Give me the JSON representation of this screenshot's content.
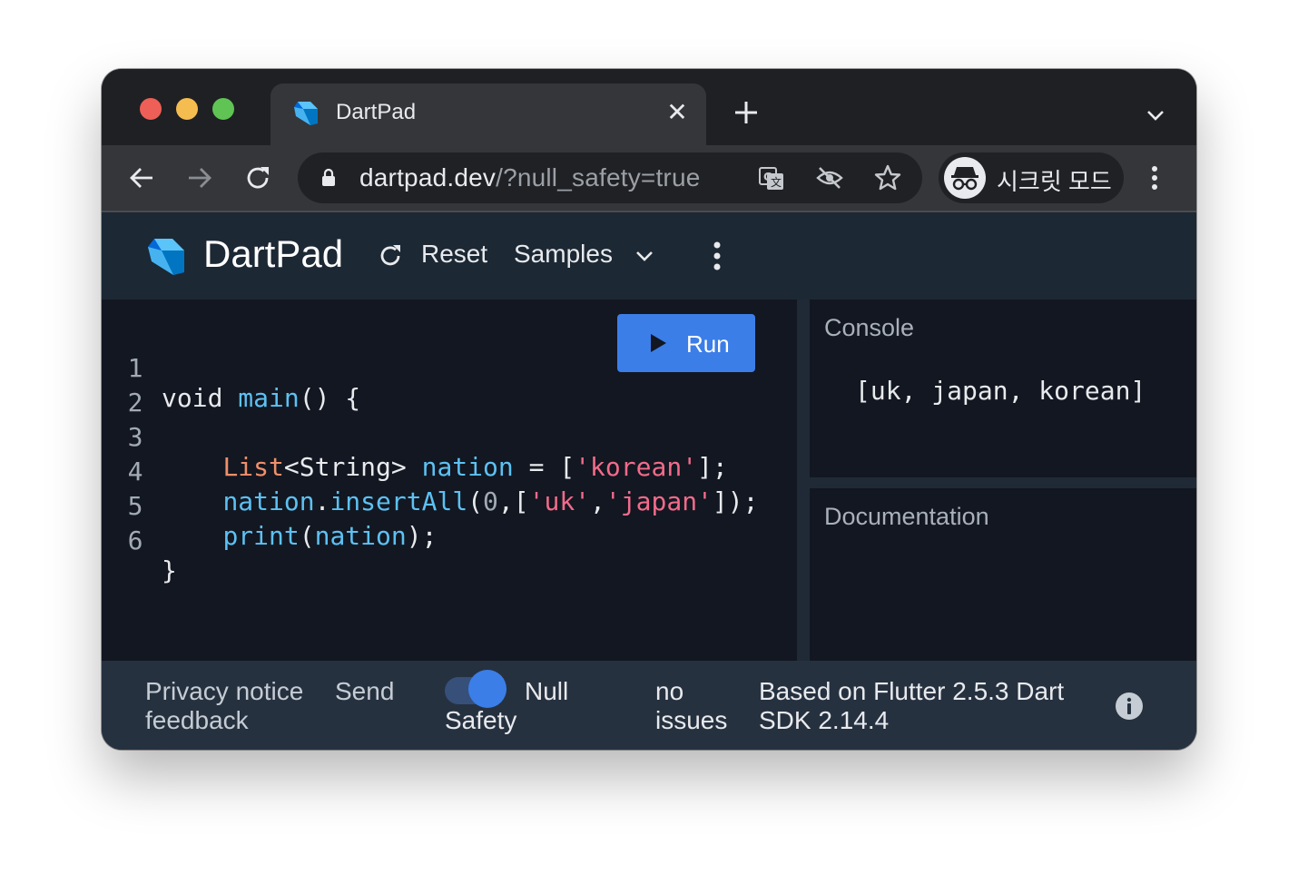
{
  "tab": {
    "title": "DartPad",
    "close": "✕"
  },
  "address_bar": {
    "host": "dartpad.dev",
    "path": "/?null_safety=true"
  },
  "incognito": {
    "label": "시크릿 모드"
  },
  "header": {
    "title": "DartPad",
    "reset_label": "Reset",
    "samples_label": "Samples"
  },
  "editor": {
    "run_label": "Run",
    "line_numbers": [
      "1",
      "2",
      "3",
      "4",
      "5",
      "6"
    ]
  },
  "console": {
    "title": "Console",
    "output": "[uk, japan, korean]"
  },
  "documentation": {
    "title": "Documentation"
  },
  "footer": {
    "privacy_notice": "Privacy notice",
    "send_feedback_1": "Send",
    "send_feedback_2": "feedback",
    "null_safety_1": "Null",
    "null_safety_2": "Safety",
    "null_safety_enabled": true,
    "issues_1": "no",
    "issues_2": "issues",
    "version_1": "Based on Flutter 2.5.3 Dart",
    "version_2": "SDK 2.14.4"
  },
  "colors": {
    "accent": "#3b7ee8",
    "function": "#5dc1f3",
    "type": "#f08f6a",
    "string": "#f36b8a"
  }
}
